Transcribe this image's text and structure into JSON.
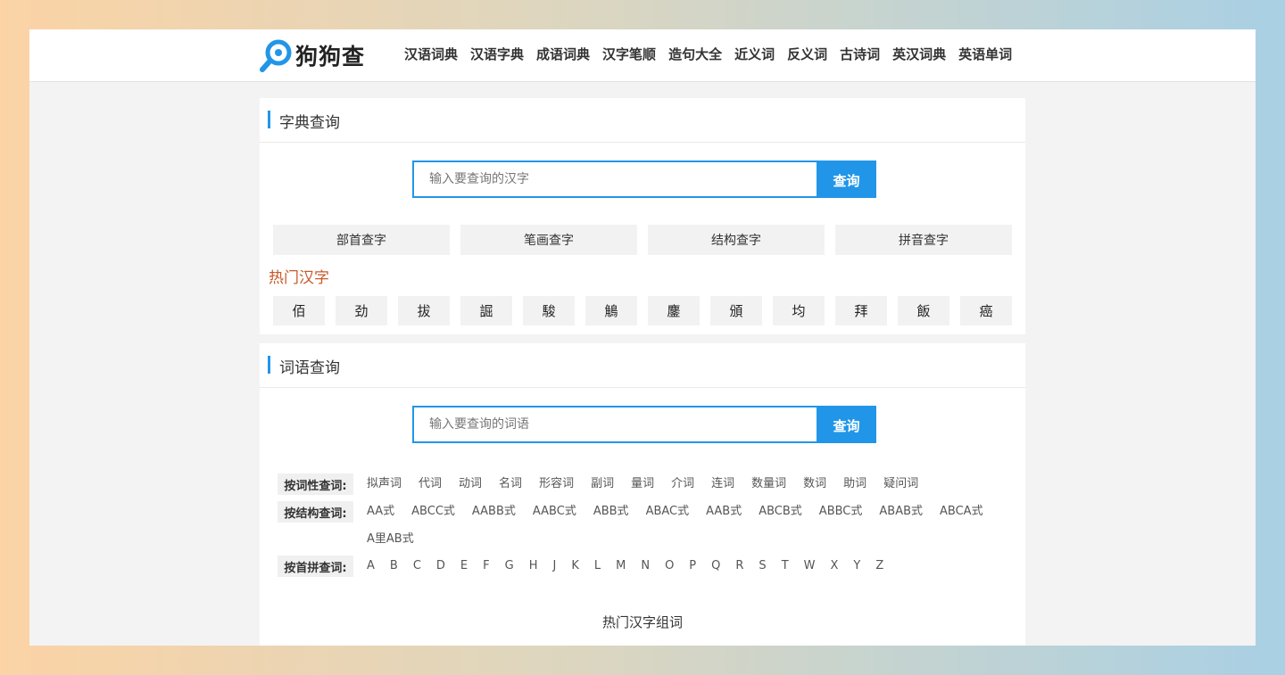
{
  "header": {
    "logo_text": "狗狗查",
    "nav": [
      "汉语词典",
      "汉语字典",
      "成语词典",
      "汉字笔顺",
      "造句大全",
      "近义词",
      "反义词",
      "古诗词",
      "英汉词典",
      "英语单词"
    ]
  },
  "char_section": {
    "title": "字典查询",
    "search_placeholder": "输入要查询的汉字",
    "search_button": "查询",
    "methods": [
      "部首查字",
      "笔画查字",
      "结构查字",
      "拼音查字"
    ],
    "hot_title": "热门汉字",
    "hot_chars": [
      "佰",
      "劲",
      "拔",
      "誳",
      "駿",
      "鵤",
      "鏖",
      "頒",
      "均",
      "拜",
      "飯",
      "癌"
    ]
  },
  "word_section": {
    "title": "词语查询",
    "search_placeholder": "输入要查询的词语",
    "search_button": "查询",
    "pos_label": "按词性查词:",
    "pos_items": [
      "拟声词",
      "代词",
      "动词",
      "名词",
      "形容词",
      "副词",
      "量词",
      "介词",
      "连词",
      "数量词",
      "数词",
      "助词",
      "疑问词"
    ],
    "struct_label": "按结构查词:",
    "struct_items": [
      "AA式",
      "ABCC式",
      "AABB式",
      "AABC式",
      "ABB式",
      "ABAC式",
      "AAB式",
      "ABCB式",
      "ABBC式",
      "ABAB式",
      "ABCA式",
      "A里AB式"
    ],
    "pinyin_label": "按首拼查词:",
    "pinyin_items": [
      "A",
      "B",
      "C",
      "D",
      "E",
      "F",
      "G",
      "H",
      "J",
      "K",
      "L",
      "M",
      "N",
      "O",
      "P",
      "Q",
      "R",
      "S",
      "T",
      "W",
      "X",
      "Y",
      "Z"
    ],
    "hot_words_title": "热门汉字组词"
  },
  "colors": {
    "accent": "#2196e8",
    "hot_title": "#c9592a"
  }
}
